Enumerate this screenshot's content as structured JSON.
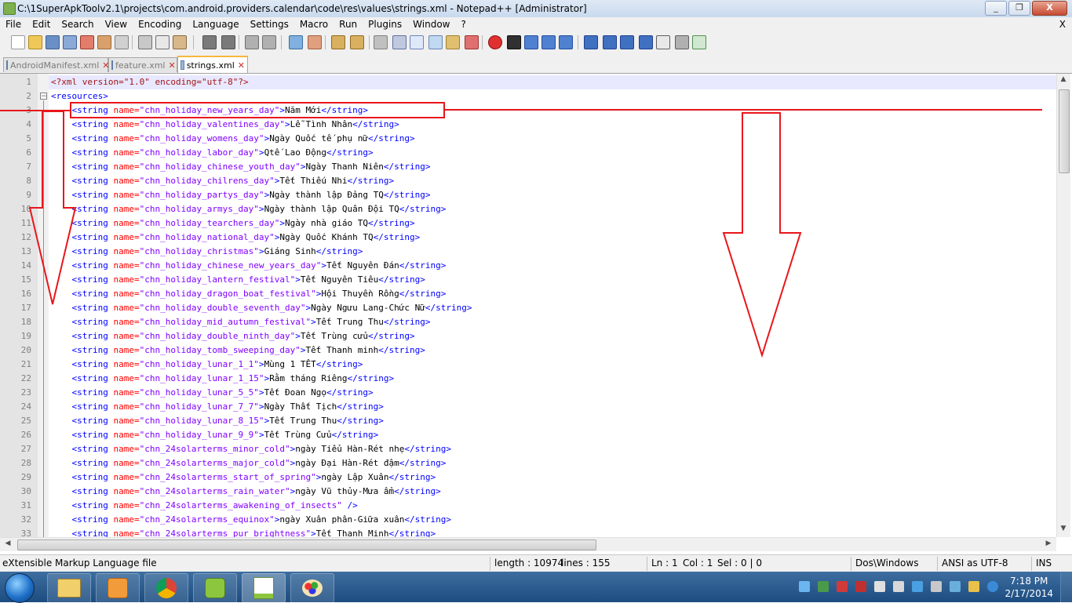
{
  "window": {
    "title": "C:\\1SuperApkToolv2.1\\projects\\com.android.providers.calendar\\code\\res\\values\\strings.xml - Notepad++ [Administrator]",
    "min": "_",
    "max": "❐",
    "close": "X"
  },
  "menu": {
    "items": [
      "File",
      "Edit",
      "Search",
      "View",
      "Encoding",
      "Language",
      "Settings",
      "Macro",
      "Run",
      "Plugins",
      "Window",
      "?"
    ],
    "close": "X"
  },
  "tabs": [
    {
      "label": "AndroidManifest.xml",
      "active": false
    },
    {
      "label": "feature.xml",
      "active": false
    },
    {
      "label": "strings.xml",
      "active": true
    }
  ],
  "editor": {
    "lines": [
      {
        "num": "1",
        "pre": "",
        "kind": "pi",
        "text": "<?xml version=\"1.0\" encoding=\"utf-8\"?>"
      },
      {
        "num": "2",
        "pre": "",
        "kind": "open",
        "text": "<resources>"
      },
      {
        "num": "3",
        "name": "chn_holiday_new_years_day",
        "value": "Năm Mới"
      },
      {
        "num": "4",
        "name": "chn_holiday_valentines_day",
        "value": "Lễ Tình Nhân"
      },
      {
        "num": "5",
        "name": "chn_holiday_womens_day",
        "value": "Ngày Quốc tế phụ nữ"
      },
      {
        "num": "6",
        "name": "chn_holiday_labor_day",
        "value": "Qtế Lao Động"
      },
      {
        "num": "7",
        "name": "chn_holiday_chinese_youth_day",
        "value": "Ngày Thanh Niên"
      },
      {
        "num": "8",
        "name": "chn_holiday_chilrens_day",
        "value": "Tết Thiếu Nhi"
      },
      {
        "num": "9",
        "name": "chn_holiday_partys_day",
        "value": "Ngày thành lập Đảng TQ"
      },
      {
        "num": "10",
        "name": "chn_holiday_armys_day",
        "value": "Ngày thành lập Quân Đội TQ"
      },
      {
        "num": "11",
        "name": "chn_holiday_tearchers_day",
        "value": "Ngày nhà giáo TQ"
      },
      {
        "num": "12",
        "name": "chn_holiday_national_day",
        "value": "Ngày Quốc Khánh TQ"
      },
      {
        "num": "13",
        "name": "chn_holiday_christmas",
        "value": "Giáng Sinh"
      },
      {
        "num": "14",
        "name": "chn_holiday_chinese_new_years_day",
        "value": "Tết Nguyên Đán"
      },
      {
        "num": "15",
        "name": "chn_holiday_lantern_festival",
        "value": "Tết Nguyên Tiêu"
      },
      {
        "num": "16",
        "name": "chn_holiday_dragon_boat_festival",
        "value": "Hội Thuyền Rồng"
      },
      {
        "num": "17",
        "name": "chn_holiday_double_seventh_day",
        "value": "Ngày Ngưu Lang-Chức Nữ"
      },
      {
        "num": "18",
        "name": "chn_holiday_mid_autumn_festival",
        "value": "Tết Trung Thu"
      },
      {
        "num": "19",
        "name": "chn_holiday_double_ninth_day",
        "value": "Tết Trùng cửu"
      },
      {
        "num": "20",
        "name": "chn_holiday_tomb_sweeping_day",
        "value": "Tết Thanh minh"
      },
      {
        "num": "21",
        "name": "chn_holiday_lunar_1_1",
        "value": "Mùng 1 TẾT"
      },
      {
        "num": "22",
        "name": "chn_holiday_lunar_1_15",
        "value": "Rằm tháng Riêng"
      },
      {
        "num": "23",
        "name": "chn_holiday_lunar_5_5",
        "value": "Tết Đoan Ngọ"
      },
      {
        "num": "24",
        "name": "chn_holiday_lunar_7_7",
        "value": "Ngày Thất Tịch"
      },
      {
        "num": "25",
        "name": "chn_holiday_lunar_8_15",
        "value": "Tết Trung Thu"
      },
      {
        "num": "26",
        "name": "chn_holiday_lunar_9_9",
        "value": "Tết Trùng Cửu"
      },
      {
        "num": "27",
        "name": "chn_24solarterms_minor_cold",
        "value": "ngày Tiểu Hàn-Rét nhẹ"
      },
      {
        "num": "28",
        "name": "chn_24solarterms_major_cold",
        "value": "ngày Đại Hàn-Rét đậm"
      },
      {
        "num": "29",
        "name": "chn_24solarterms_start_of_spring",
        "value": "ngày Lập Xuân"
      },
      {
        "num": "30",
        "name": "chn_24solarterms_rain_water",
        "value": "ngày Vũ thủy-Mưa ẩm"
      },
      {
        "num": "31",
        "name": "chn_24solarterms_awakening_of_insects",
        "selfclose": true,
        "value": ""
      },
      {
        "num": "32",
        "name": "chn_24solarterms_equinox",
        "value": "ngày Xuân phân-Giữa xuân"
      },
      {
        "num": "33",
        "name": "chn_24solarterms_pur_brightness",
        "value": "Tết Thanh Minh"
      }
    ]
  },
  "status": {
    "filetype": "eXtensible Markup Language file",
    "length": "length : 10974",
    "lines": "lines : 155",
    "ln": "Ln : 1",
    "col": "Col : 1",
    "sel": "Sel : 0 | 0",
    "eol": "Dos\\Windows",
    "encoding": "ANSI as UTF-8",
    "mode": "INS"
  },
  "taskbar": {
    "time": "7:18 PM",
    "date": "2/17/2014"
  },
  "colors": {
    "annotation": "#e8161b",
    "tag": "#0000ff",
    "attr": "#ff0000",
    "value": "#8000ff",
    "pi": "#a31515"
  }
}
